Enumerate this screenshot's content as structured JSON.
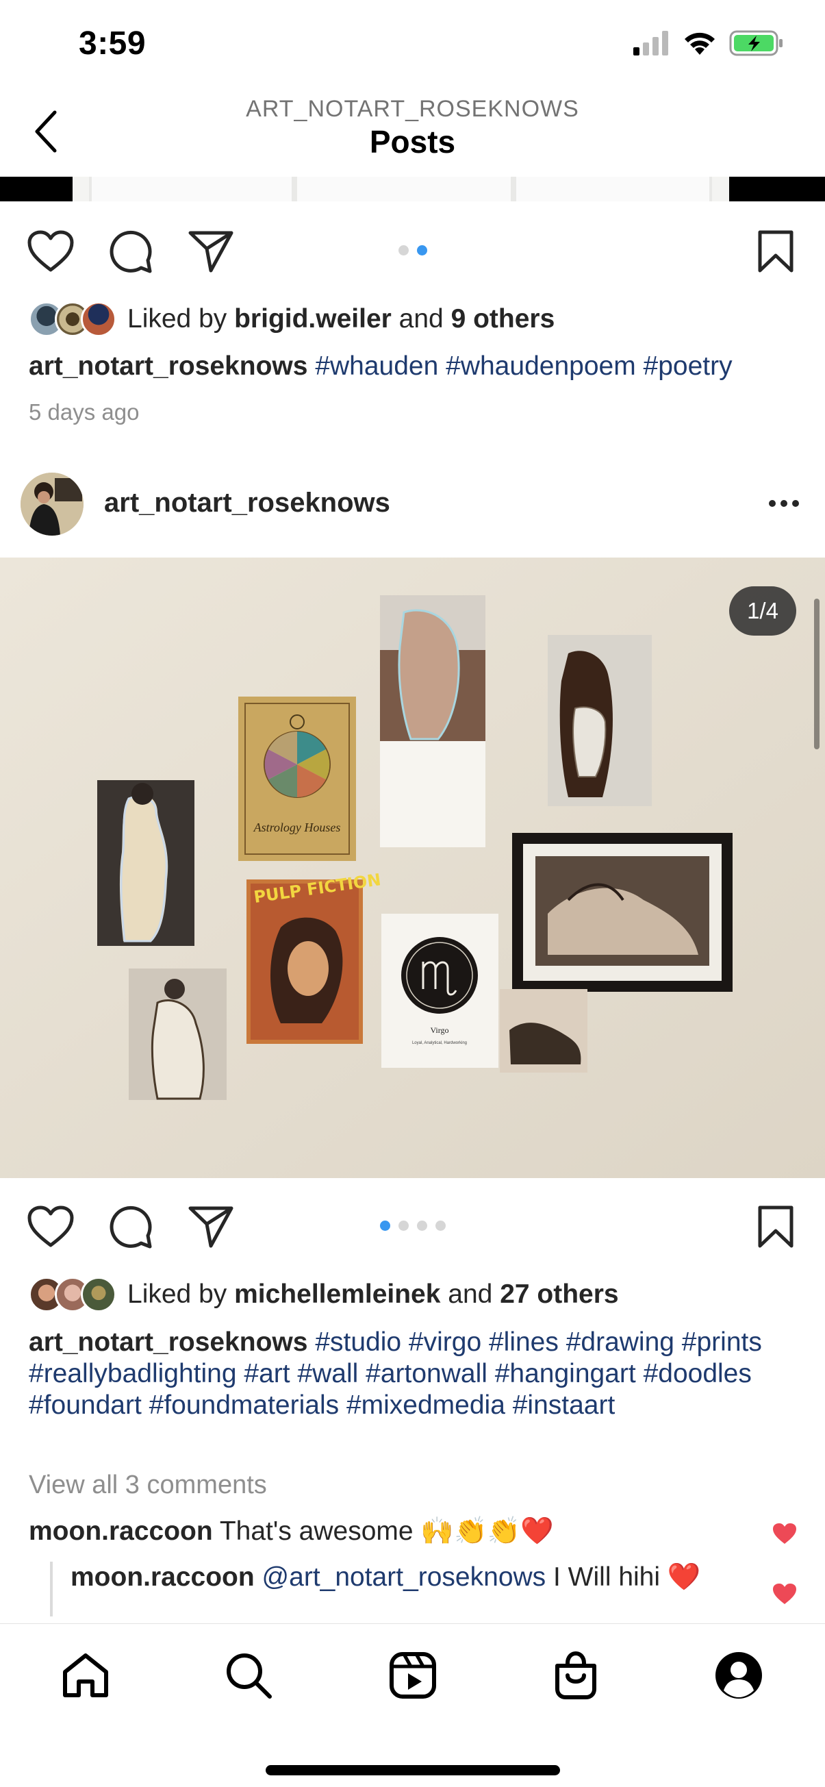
{
  "status": {
    "time": "3:59"
  },
  "header": {
    "username": "ART_NOTART_ROSEKNOWS",
    "title": "Posts"
  },
  "colors": {
    "accent": "#3897f0",
    "hashtag": "#1e3a6e",
    "like_heart": "#ed4956",
    "battery": "#4cd964"
  },
  "post1": {
    "liked_by_prefix": "Liked by ",
    "liked_by_user": "brigid.weiler",
    "liked_by_and": " and ",
    "liked_by_others": "9 others",
    "caption_user": "art_notart_roseknows",
    "caption_tags": "#whauden #whaudenpoem #poetry",
    "time_ago": "5 days ago",
    "carousel_count": 2,
    "carousel_active": 2
  },
  "post2": {
    "username": "art_notart_roseknows",
    "image_counter": "1/4",
    "carousel_count": 4,
    "carousel_active": 1,
    "liked_by_prefix": "Liked by ",
    "liked_by_user": "michellemleinek",
    "liked_by_and": " and ",
    "liked_by_others": "27 others",
    "caption_user": "art_notart_roseknows",
    "caption_tags": "#studio #virgo #lines #drawing #prints #reallybadlighting #art #wall #artonwall #hangingart #doodles #foundart #foundmaterials #mixedmedia #instaart",
    "view_comments": "View all 3 comments",
    "comments": [
      {
        "user": "moon.raccoon",
        "text": "That's awesome 🙌👏👏❤️"
      },
      {
        "user": "moon.raccoon",
        "mention": "@art_notart_roseknows",
        "text": "I Will hihi ❤️"
      }
    ],
    "photo_text": {
      "astrology": "Astrology Houses",
      "pulp": "PULP FICTION",
      "virgo": "Virgo",
      "virgo_sub": "Loyal, Analytical, Hardworking"
    }
  },
  "tabbar": {
    "icons": [
      "home-icon",
      "search-icon",
      "reels-icon",
      "shop-icon",
      "profile-icon"
    ]
  }
}
